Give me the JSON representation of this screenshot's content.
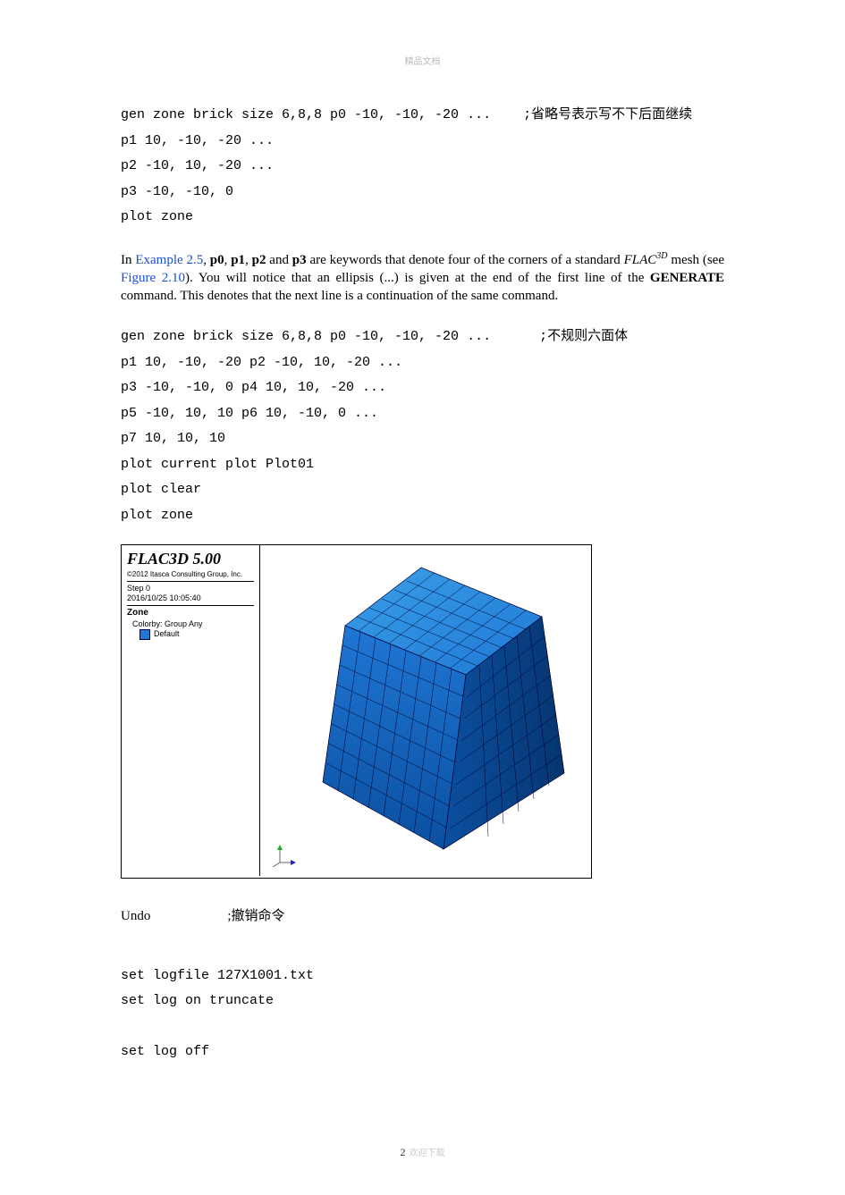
{
  "header": "精品文档",
  "code1": {
    "l1": "gen zone brick size 6,8,8 p0 -10, -10, -20 ...    ;省略号表示写不下后面继续",
    "l2": "p1 10, -10, -20 ...",
    "l3": "p2 -10, 10, -20 ...",
    "l4": "p3 -10, -10, 0",
    "l5": "plot zone"
  },
  "para": {
    "lead": "In ",
    "link1": "Example 2.5",
    "t1": ", ",
    "b1": "p0",
    "c1": ", ",
    "b2": "p1",
    "c2": ", ",
    "b3": "p2",
    "c3": " and ",
    "b4": "p3",
    "t2": " are keywords that denote four of the corners of a standard ",
    "ital": "FLAC",
    "sup": "3D",
    "t3": " mesh (see ",
    "link2": "Figure 2.10",
    "t4": "). You will notice that an ellipsis (...) is given at the end of the first line of the ",
    "b5": "GENERATE",
    "t5": " command. This denotes that the next line is a continuation of the same command."
  },
  "code2": {
    "l1": "gen zone brick size 6,8,8 p0 -10, -10, -20 ...      ;不规则六面体",
    "l2": "p1 10, -10, -20 p2 -10, 10, -20 ...",
    "l3": "p3 -10, -10, 0 p4 10, 10, -20 ...",
    "l4": "p5 -10, 10, 10 p6 10, -10, 0 ...",
    "l5": "p7 10, 10, 10",
    "l6": "plot current plot Plot01",
    "l7": "plot clear",
    "l8": "plot zone"
  },
  "figure": {
    "title": "FLAC3D 5.00",
    "copyright": "©2012 Itasca Consulting Group, Inc.",
    "step": "Step 0",
    "date": "2016/10/25 10:05:40",
    "zone": "Zone",
    "colorby": "Colorby: Group    Any",
    "default": "Default"
  },
  "undo": {
    "cmd": "Undo",
    "comment": ";撤销命令"
  },
  "code3": {
    "l1": "set logfile 127X1001.txt",
    "l2": "set log on truncate",
    "blank": " ",
    "l3": "set log off"
  },
  "footer": {
    "pagenum": "2",
    "dl": "欢迎下载"
  }
}
